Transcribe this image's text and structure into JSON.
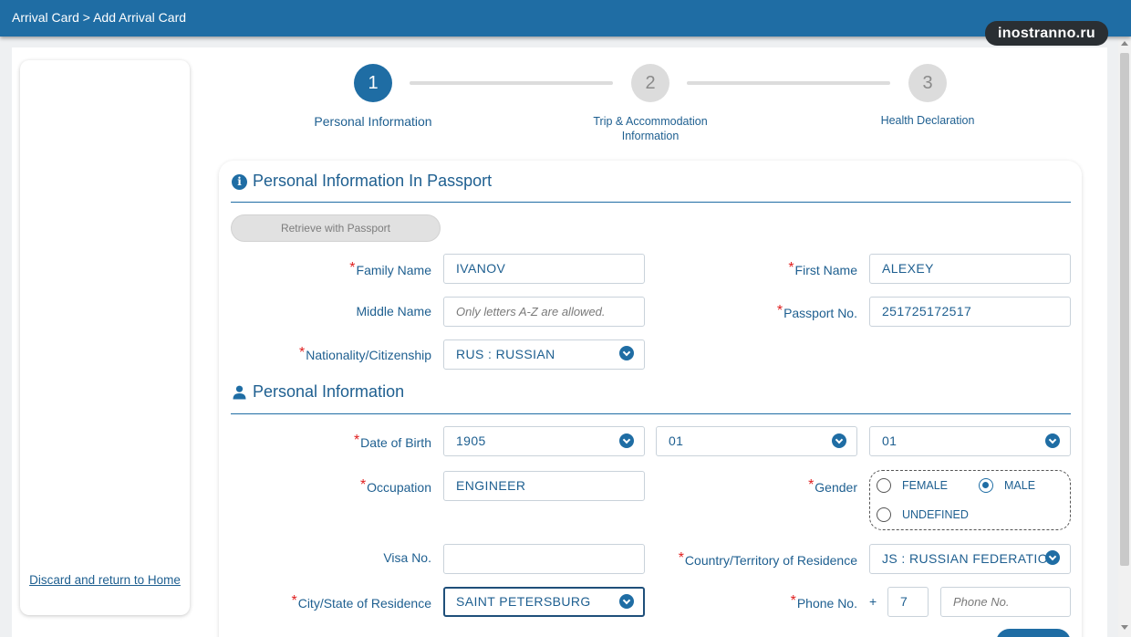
{
  "header": {
    "breadcrumb": "Arrival Card > Add Arrival Card"
  },
  "watermark": "inostranno.ru",
  "sidebar": {
    "discard_label": "Discard and return to Home"
  },
  "steps": [
    {
      "number": "1",
      "label": "Personal Information",
      "state": "active"
    },
    {
      "number": "2",
      "label": "Trip & Accommodation Information",
      "state": "inactive"
    },
    {
      "number": "3",
      "label": "Health Declaration",
      "state": "inactive"
    }
  ],
  "passport_section": {
    "title": "Personal Information In Passport",
    "icon": "info-icon",
    "retrieve_label": "Retrieve with Passport",
    "family_name": {
      "label": "Family Name",
      "value": "IVANOV",
      "required": true
    },
    "first_name": {
      "label": "First Name",
      "value": "ALEXEY",
      "required": true
    },
    "middle_name": {
      "label": "Middle Name",
      "placeholder": "Only letters A-Z are allowed.",
      "required": false
    },
    "passport_no": {
      "label": "Passport No.",
      "value": "251725172517",
      "required": true
    },
    "nationality": {
      "label": "Nationality/Citizenship",
      "value": "RUS : RUSSIAN",
      "required": true
    }
  },
  "personal_section": {
    "title": "Personal Information",
    "icon": "person-icon",
    "dob": {
      "label": "Date of Birth",
      "year": "1905",
      "month": "01",
      "day": "01",
      "required": true
    },
    "occupation": {
      "label": "Occupation",
      "value": "ENGINEER",
      "required": true
    },
    "gender": {
      "label": "Gender",
      "required": true,
      "options": [
        "FEMALE",
        "MALE",
        "UNDEFINED"
      ],
      "selected": "MALE"
    },
    "visa_no": {
      "label": "Visa No.",
      "value": "",
      "required": false
    },
    "country_residence": {
      "label": "Country/Territory of Residence",
      "value": "JS : RUSSIAN FEDERATION",
      "required": true
    },
    "city_residence": {
      "label": "City/State of Residence",
      "value": "SAINT PETERSBURG",
      "required": true
    },
    "phone": {
      "label": "Phone No.",
      "prefix": "+",
      "code": "7",
      "placeholder": "Phone No.",
      "required": true
    }
  },
  "colors": {
    "primary": "#1f6da4",
    "text": "#1e5f90",
    "required": "#e02020"
  }
}
